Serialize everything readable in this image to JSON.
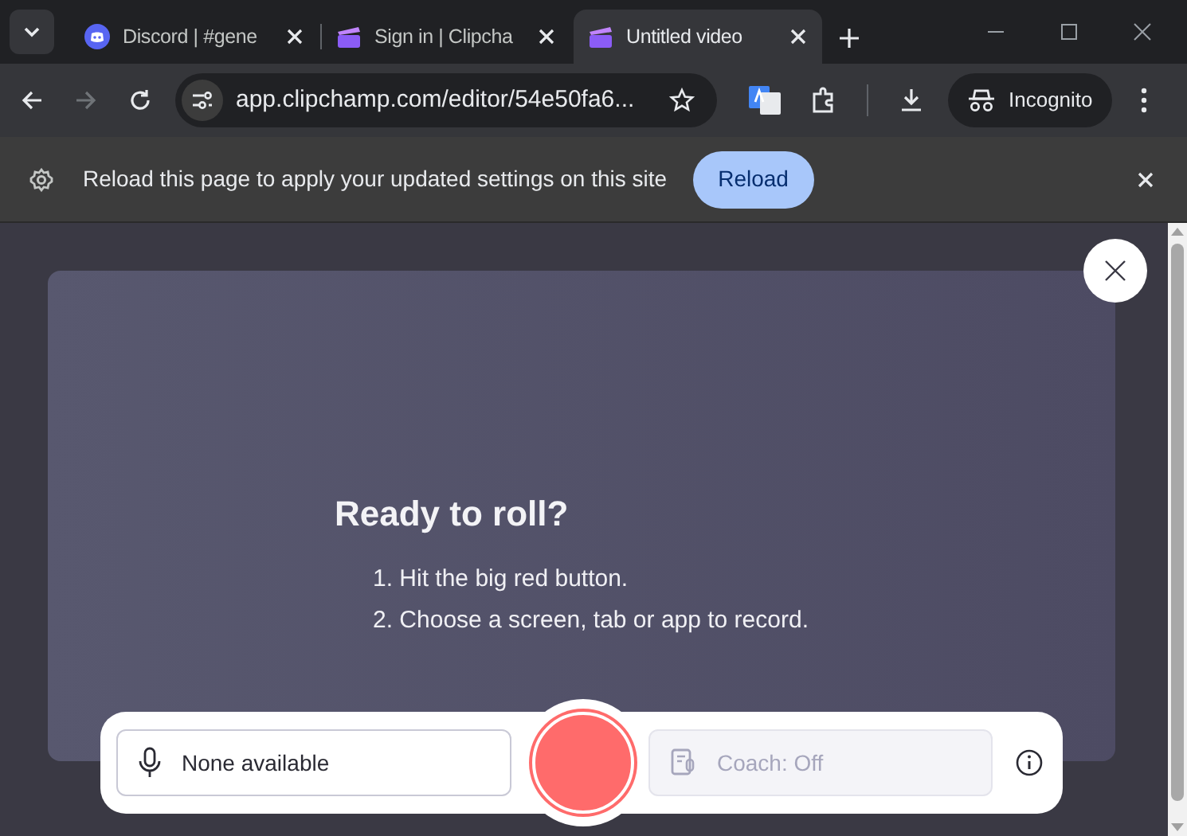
{
  "tabs": [
    {
      "title": "Discord | #gene",
      "kind": "discord",
      "selected": false
    },
    {
      "title": "Sign in | Clipcha",
      "kind": "clipchamp",
      "selected": false
    },
    {
      "title": "Untitled video",
      "kind": "clipchamp",
      "selected": true
    }
  ],
  "address_bar": {
    "url": "app.clipchamp.com/editor/54e50fa6..."
  },
  "profile": {
    "label": "Incognito"
  },
  "infobar": {
    "message": "Reload this page to apply your updated settings on this site",
    "button": "Reload"
  },
  "recorder": {
    "title": "Ready to roll?",
    "steps": [
      "1. Hit the big red button.",
      "2. Choose a screen, tab or app to record."
    ],
    "microphone": "None available",
    "coach": {
      "label": "Coach: Off",
      "disabled": true
    }
  }
}
